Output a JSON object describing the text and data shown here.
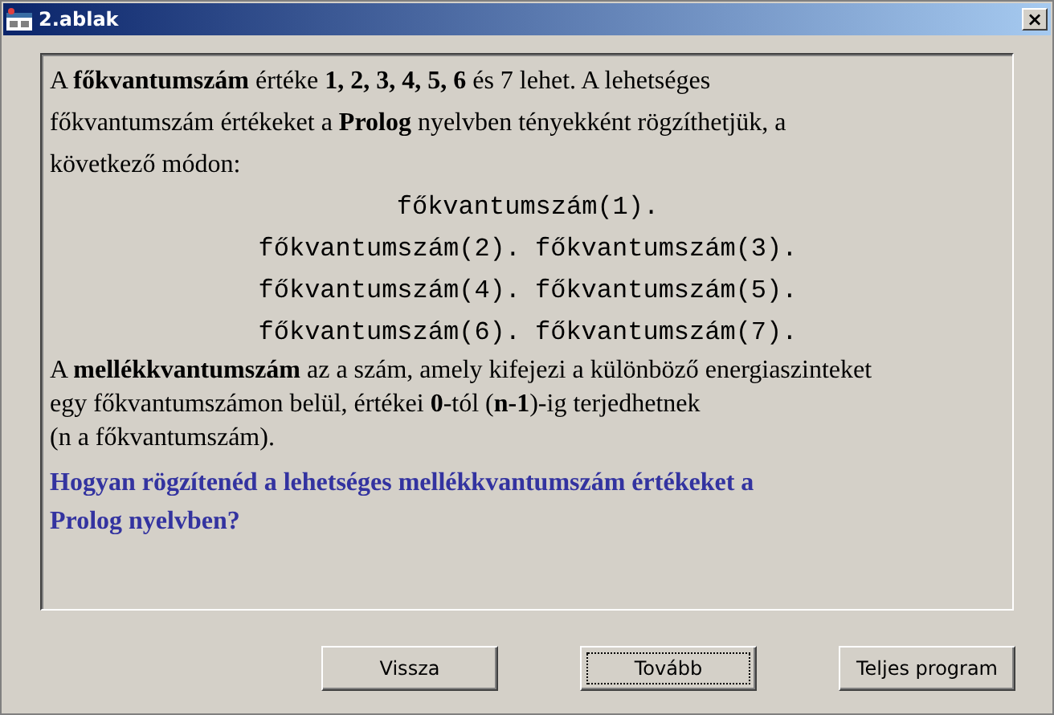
{
  "window": {
    "title": "2.ablak",
    "close": "×"
  },
  "intro": {
    "lines": [
      "A **főkvantumszám** értéke **1, 2, 3, 4, 5, 6** és 7 lehet. A lehetséges",
      "főkvantumszám értékeket a **Prolog** nyelvben tényekként rögzíthetjük, a",
      "következő módon:"
    ]
  },
  "code_lines": [
    [
      "főkvantumszám(1)."
    ],
    [
      "főkvantumszám(2).",
      "főkvantumszám(3)."
    ],
    [
      "főkvantumszám(4).",
      "főkvantumszám(5)."
    ],
    [
      "főkvantumszám(6).",
      "főkvantumszám(7)."
    ]
  ],
  "explanation": {
    "lines": [
      "A **mellékkvantumszám** az a szám, amely kifejezi a különböző energiaszinteket",
      "egy főkvantumszámon belül, értékei **0**-tól (**n-1**)-ig terjedhetnek",
      "(n a főkvantumszám)."
    ]
  },
  "question": {
    "lines": [
      "Hogyan rögzítenéd a lehetséges mellékkvantumszám értékeket a",
      "Prolog nyelvben?"
    ]
  },
  "buttons": [
    {
      "label": "Vissza",
      "focused": false
    },
    {
      "label": "Tovább",
      "focused": true
    },
    {
      "label": "Teljes program",
      "focused": false
    }
  ]
}
